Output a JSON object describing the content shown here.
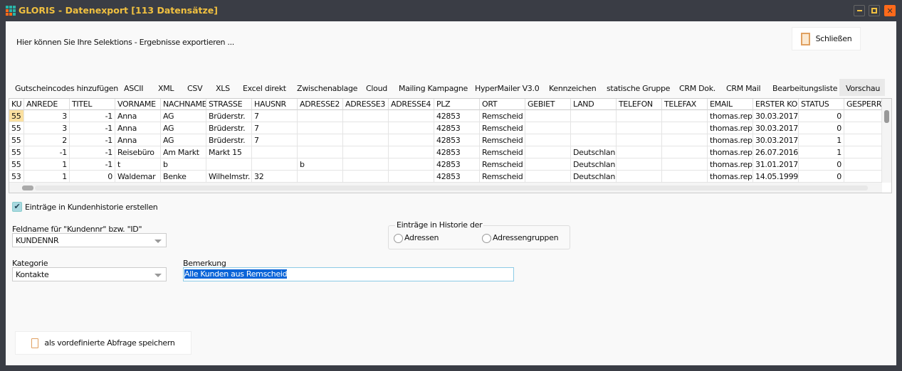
{
  "window": {
    "title": "GLORIS - Datenexport [113 Datensätze]",
    "colors": {
      "title": "#f0c040",
      "close": "#ff6a1a",
      "frame": "#3a3d45"
    }
  },
  "header": {
    "intro": "Hier können Sie Ihre Selektions - Ergebnisse exportieren ...",
    "close_label": "Schließen"
  },
  "tabs": [
    {
      "label": "Gutscheincodes hinzufügen"
    },
    {
      "label": "ASCII"
    },
    {
      "label": "XML"
    },
    {
      "label": "CSV"
    },
    {
      "label": "XLS"
    },
    {
      "label": "Excel direkt"
    },
    {
      "label": "Zwischenablage"
    },
    {
      "label": "Cloud"
    },
    {
      "label": "Mailing Kampagne"
    },
    {
      "label": "HyperMailer V3.0"
    },
    {
      "label": "Kennzeichen"
    },
    {
      "label": "statische Gruppe"
    },
    {
      "label": "CRM Dok."
    },
    {
      "label": "CRM Mail"
    },
    {
      "label": "Bearbeitungsliste"
    },
    {
      "label": "Vorschau",
      "active": true
    }
  ],
  "grid": {
    "columns": [
      "KU",
      "ANREDE",
      "TITEL",
      "VORNAME",
      "NACHNAME",
      "STRASSE",
      "HAUSNR",
      "ADRESSE2",
      "ADRESSE3",
      "ADRESSE4",
      "PLZ",
      "ORT",
      "GEBIET",
      "LAND",
      "TELEFON",
      "TELEFAX",
      "EMAIL",
      "ERSTER KO",
      "STATUS",
      "GESPERRT"
    ],
    "rows": [
      [
        "55",
        "3",
        "-1",
        "Anna",
        "AG",
        "Brüderstr.",
        "7",
        "",
        "",
        "",
        "42853",
        "Remscheid",
        "",
        "",
        "",
        "",
        "thomas.rep",
        "30.03.2017",
        "0",
        ""
      ],
      [
        "55",
        "3",
        "-1",
        "Anna",
        "AG",
        "Brüderstr.",
        "7",
        "",
        "",
        "",
        "42853",
        "Remscheid",
        "",
        "",
        "",
        "",
        "thomas.rep",
        "30.03.2017",
        "0",
        ""
      ],
      [
        "55",
        "2",
        "-1",
        "Anna",
        "AG",
        "Brüderstr.",
        "7",
        "",
        "",
        "",
        "42853",
        "Remscheid",
        "",
        "",
        "",
        "",
        "thomas.rep",
        "30.03.2017",
        "1",
        ""
      ],
      [
        "55",
        "-1",
        "-1",
        "Reisebüro",
        "Am Markt",
        "Markt 15",
        "",
        "",
        "",
        "",
        "42853",
        "Remscheid",
        "",
        "Deutschlan",
        "",
        "",
        "thomas.rep",
        "26.07.2016",
        "1",
        ""
      ],
      [
        "55",
        "1",
        "-1",
        "t",
        "b",
        "",
        "",
        "b",
        "",
        "",
        "42853",
        "Remscheid",
        "",
        "Deutschlan",
        "",
        "",
        "thomas.rep",
        "31.01.2017",
        "0",
        ""
      ],
      [
        "53",
        "1",
        "0",
        "Waldemar",
        "Benke",
        "Wilhelmstr.",
        "32",
        "",
        "",
        "",
        "42853",
        "Remscheid",
        "",
        "Deutschlan",
        "",
        "",
        "thomas.rep",
        "14.05.1999",
        "0",
        ""
      ]
    ]
  },
  "form": {
    "history_checkbox": {
      "label": "Einträge in Kundenhistorie erstellen",
      "checked": true
    },
    "field_label": "Feldname für \"Kundennr\" bzw. \"ID\"",
    "field_value": "KUNDENNR",
    "group_label": "Einträge in Historie der",
    "radio1": "Adressen",
    "radio2": "Adressengruppen",
    "category_label": "Kategorie",
    "category_value": "Kontakte",
    "remark_label": "Bemerkung",
    "remark_value": "Alle Kunden aus Remscheid"
  },
  "footer": {
    "save_query_label": "als vordefinierte Abfrage speichern"
  }
}
